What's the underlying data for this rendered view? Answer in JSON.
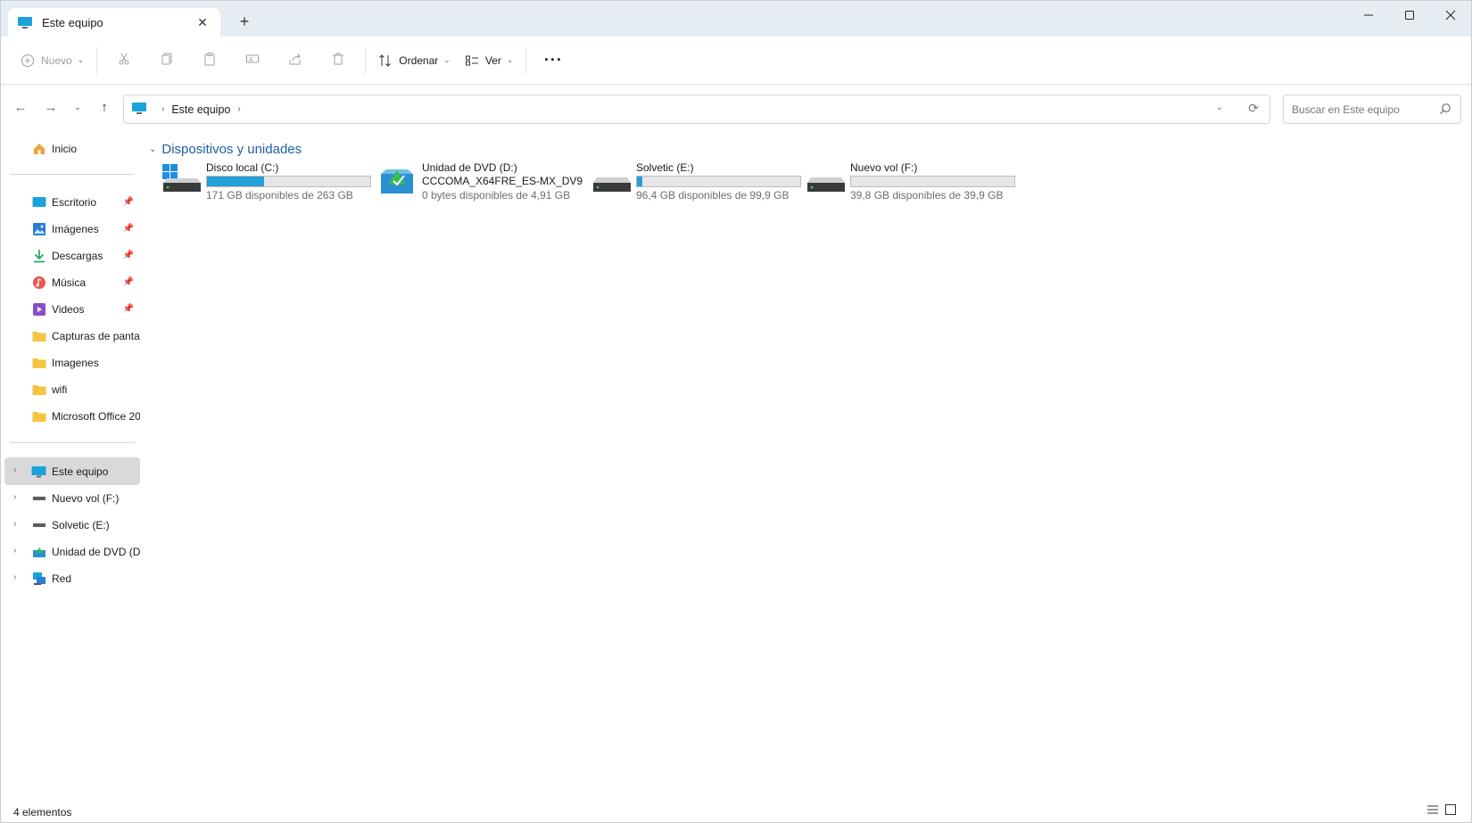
{
  "window": {
    "tab_title": "Este equipo",
    "new_tab_symbol": "+",
    "controls": [
      "minimize",
      "maximize",
      "close"
    ]
  },
  "toolbar": {
    "new_label": "Nuevo",
    "sort_label": "Ordenar",
    "view_label": "Ver",
    "more_symbol": "···"
  },
  "address": {
    "crumb": "Este equipo",
    "search_placeholder": "Buscar en Este equipo"
  },
  "sidebar": {
    "home": "Inicio",
    "quick_access": [
      {
        "label": "Escritorio",
        "icon": "desktop-icon",
        "pinned": true
      },
      {
        "label": "Imágenes",
        "icon": "pictures-icon",
        "pinned": true
      },
      {
        "label": "Descargas",
        "icon": "downloads-icon",
        "pinned": true
      },
      {
        "label": "Música",
        "icon": "music-icon",
        "pinned": true
      },
      {
        "label": "Videos",
        "icon": "videos-icon",
        "pinned": true
      },
      {
        "label": "Capturas de pantall",
        "icon": "folder-icon",
        "pinned": false
      },
      {
        "label": "Imagenes",
        "icon": "folder-icon",
        "pinned": false
      },
      {
        "label": "wifi",
        "icon": "folder-icon",
        "pinned": false
      },
      {
        "label": "Microsoft Office 20",
        "icon": "folder-icon",
        "pinned": false
      }
    ],
    "tree": [
      {
        "label": "Este equipo",
        "icon": "pc-icon",
        "selected": true
      },
      {
        "label": "Nuevo vol (F:)",
        "icon": "drive-icon"
      },
      {
        "label": "Solvetic (E:)",
        "icon": "drive-icon"
      },
      {
        "label": "Unidad de DVD (D:)",
        "icon": "dvd-icon"
      },
      {
        "label": "Red",
        "icon": "network-icon"
      }
    ]
  },
  "content": {
    "group_title": "Dispositivos y unidades",
    "drives": [
      {
        "name": "Disco local (C:)",
        "free_text": "171 GB disponibles de 263 GB",
        "used_fraction": 0.35,
        "icon": "windows-drive-icon"
      },
      {
        "name": "Unidad de DVD (D:)",
        "name2": "CCCOMA_X64FRE_ES-MX_DV9",
        "free_text": "0 bytes disponibles de 4,91 GB",
        "icon": "dvd-drive-icon"
      },
      {
        "name": "Solvetic (E:)",
        "free_text": "96,4 GB disponibles de 99,9 GB",
        "used_fraction": 0.035,
        "icon": "hdd-icon"
      },
      {
        "name": "Nuevo vol (F:)",
        "free_text": "39,8 GB disponibles de 39,9 GB",
        "used_fraction": 0.0,
        "icon": "hdd-icon"
      }
    ]
  },
  "status": {
    "count": "4 elementos"
  },
  "colors": {
    "accent": "#26a0da",
    "group_header": "#1a5fa8",
    "titlebar": "#e6edf2"
  }
}
